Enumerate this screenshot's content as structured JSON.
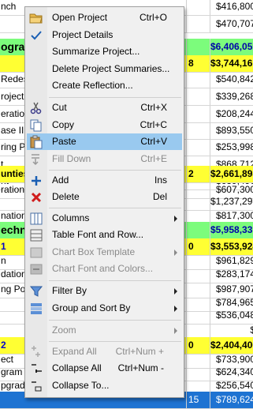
{
  "grid": {
    "rows": [
      {
        "name": "nch",
        "num": "",
        "amount": "$416,800",
        "style": ""
      },
      {
        "name": "",
        "num": "",
        "amount": "$470,707",
        "style": ""
      },
      {
        "name": "ogra",
        "num": "",
        "amount": "$6,406,059",
        "style": "green"
      },
      {
        "name": "",
        "num": "8",
        "amount": "$3,744,161",
        "style": "yellow"
      },
      {
        "name": "Redesi",
        "num": "",
        "amount": "$540,842",
        "style": ""
      },
      {
        "name": "roject",
        "num": "",
        "amount": "$339,268",
        "style": ""
      },
      {
        "name": "eration P",
        "num": "",
        "amount": "$208,244",
        "style": ""
      },
      {
        "name": "ase II",
        "num": "",
        "amount": "$893,550",
        "style": ""
      },
      {
        "name": "ring Pro",
        "num": "",
        "amount": "$253,998",
        "style": ""
      },
      {
        "name": "t",
        "num": "",
        "amount": "$868,712",
        "style": ""
      },
      {
        "name": "ht",
        "num": "",
        "amount": "$639,496",
        "style": ""
      },
      {
        "name": "unties",
        "num": "2",
        "amount": "$2,661,898",
        "style": "yellow"
      },
      {
        "name": "ration F",
        "num": "",
        "amount": "$607,300",
        "style": ""
      },
      {
        "name": "",
        "num": "",
        "amount": "$1,237,298",
        "style": ""
      },
      {
        "name": "nation F",
        "num": "",
        "amount": "$817,300",
        "style": ""
      },
      {
        "name": "echn",
        "num": "",
        "amount": "$5,958,331",
        "style": "green"
      },
      {
        "name": "1",
        "num": "0",
        "amount": "$3,553,924",
        "style": "yellow"
      },
      {
        "name": "n",
        "num": "",
        "amount": "$961,829",
        "style": ""
      },
      {
        "name": "dation",
        "num": "",
        "amount": "$283,174",
        "style": ""
      },
      {
        "name": "ng Porta",
        "num": "",
        "amount": "$987,907",
        "style": ""
      },
      {
        "name": "",
        "num": "",
        "amount": "$784,965",
        "style": ""
      },
      {
        "name": "",
        "num": "",
        "amount": "$536,048",
        "style": ""
      },
      {
        "name": "",
        "num": "",
        "amount": "$",
        "style": ""
      },
      {
        "name": "2",
        "num": "0",
        "amount": "$2,404,406",
        "style": "yellow"
      },
      {
        "name": "ect",
        "num": "",
        "amount": "$733,900",
        "style": ""
      },
      {
        "name": "gram",
        "num": "",
        "amount": "$624,340",
        "style": ""
      },
      {
        "name": "pgrade",
        "num": "",
        "amount": "$256,540",
        "style": ""
      },
      {
        "name": "",
        "num": "15",
        "amount": "$789,624",
        "style": "blue"
      }
    ]
  },
  "menu": {
    "items": [
      {
        "key": "open",
        "label": "Open Project",
        "shortcut": "Ctrl+O",
        "icon": "folder-icon",
        "disabled": false
      },
      {
        "key": "details",
        "label": "Project Details",
        "shortcut": "",
        "icon": "checkmark-icon",
        "disabled": false
      },
      {
        "key": "summarize",
        "label": "Summarize Project...",
        "shortcut": "",
        "icon": "",
        "disabled": false
      },
      {
        "key": "delete_summaries",
        "label": "Delete Project Summaries...",
        "shortcut": "",
        "icon": "",
        "disabled": false
      },
      {
        "key": "reflection",
        "label": "Create Reflection...",
        "shortcut": "",
        "icon": "",
        "disabled": false
      },
      {
        "key": "cut",
        "label": "Cut",
        "shortcut": "Ctrl+X",
        "icon": "scissors-icon",
        "disabled": false
      },
      {
        "key": "copy",
        "label": "Copy",
        "shortcut": "Ctrl+C",
        "icon": "copy-icon",
        "disabled": false
      },
      {
        "key": "paste",
        "label": "Paste",
        "shortcut": "Ctrl+V",
        "icon": "paste-icon",
        "disabled": false
      },
      {
        "key": "filldown",
        "label": "Fill Down",
        "shortcut": "Ctrl+E",
        "icon": "fill-down-icon",
        "disabled": true
      },
      {
        "key": "add",
        "label": "Add",
        "shortcut": "Ins",
        "icon": "plus-icon",
        "disabled": false
      },
      {
        "key": "delete",
        "label": "Delete",
        "shortcut": "Del",
        "icon": "delete-x-icon",
        "disabled": false
      },
      {
        "key": "columns",
        "label": "Columns",
        "shortcut": "",
        "icon": "columns-icon",
        "disabled": false
      },
      {
        "key": "tablefont",
        "label": "Table Font and Row...",
        "shortcut": "",
        "icon": "font-icon",
        "disabled": false
      },
      {
        "key": "chartbox",
        "label": "Chart Box Template",
        "shortcut": "",
        "icon": "chart-box-icon",
        "disabled": true
      },
      {
        "key": "chartfont",
        "label": "Chart Font and Colors...",
        "shortcut": "",
        "icon": "chart-font-icon",
        "disabled": true
      },
      {
        "key": "filter",
        "label": "Filter By",
        "shortcut": "",
        "icon": "filter-icon",
        "disabled": false
      },
      {
        "key": "group",
        "label": "Group and Sort By",
        "shortcut": "",
        "icon": "group-sort-icon",
        "disabled": false
      },
      {
        "key": "zoom",
        "label": "Zoom",
        "shortcut": "",
        "icon": "",
        "disabled": true
      },
      {
        "key": "expand",
        "label": "Expand All",
        "shortcut": "Ctrl+Num +",
        "icon": "expand-all-icon",
        "disabled": true
      },
      {
        "key": "collapse",
        "label": "Collapse All",
        "shortcut": "Ctrl+Num -",
        "icon": "collapse-all-icon",
        "disabled": false
      },
      {
        "key": "collapseto",
        "label": "Collapse To...",
        "shortcut": "",
        "icon": "collapse-to-icon",
        "disabled": false
      }
    ]
  },
  "colors": {
    "highlight": "#99c9ef",
    "green_row": "#7CFC7C",
    "yellow_row": "#ffff33",
    "selected_row": "#1e73d2"
  }
}
